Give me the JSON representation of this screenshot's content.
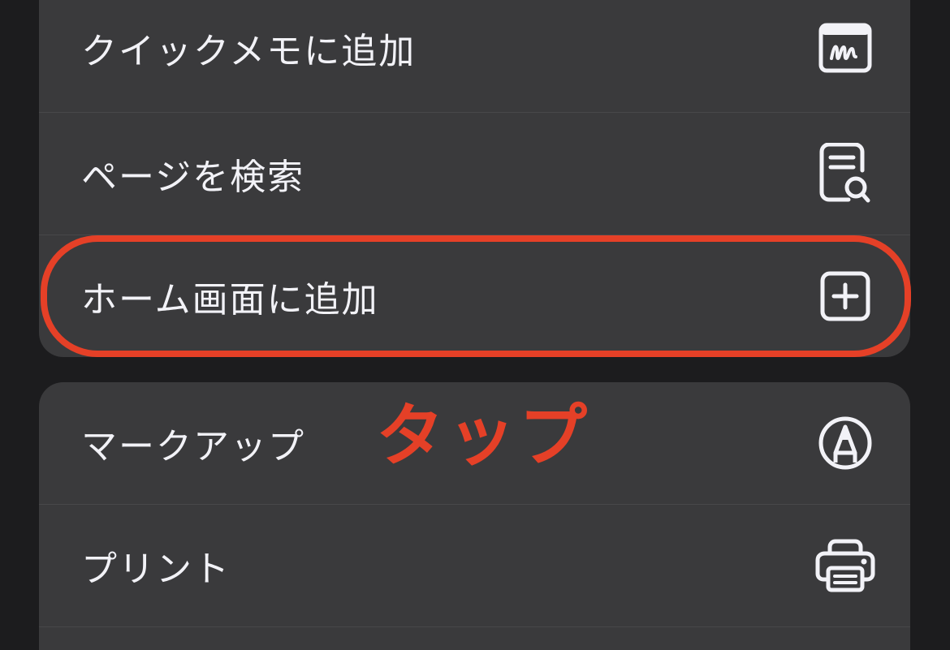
{
  "menu_group_1": {
    "items": [
      {
        "label": "クイックメモに追加",
        "icon": "quick-note-icon"
      },
      {
        "label": "ページを検索",
        "icon": "find-in-page-icon"
      },
      {
        "label": "ホーム画面に追加",
        "icon": "add-square-icon"
      }
    ]
  },
  "menu_group_2": {
    "items": [
      {
        "label": "マークアップ",
        "icon": "markup-pen-icon"
      },
      {
        "label": "プリント",
        "icon": "printer-icon"
      }
    ]
  },
  "annotation": {
    "tap_label": "タップ",
    "highlight_color": "#e54027"
  },
  "colors": {
    "background": "#1c1c1e",
    "menu_background": "#3a3a3c",
    "text": "#f2f2f7"
  }
}
